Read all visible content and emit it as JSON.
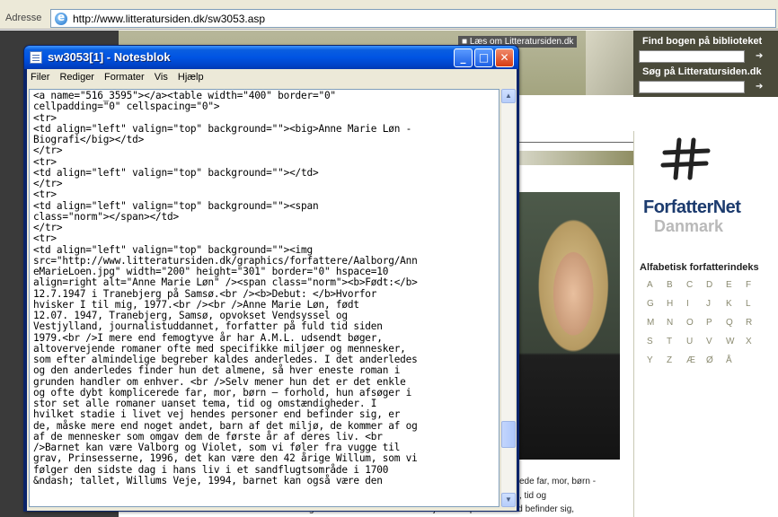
{
  "browser": {
    "address_label": "Adresse",
    "url": "http://www.litteratursiden.dk/sw3053.asp"
  },
  "site": {
    "header_link": "■ Læs om Litteratursiden.dk",
    "find_book_title": "Find bogen på biblioteket",
    "search_site_title": "Søg på Litteratursiden.dk",
    "arrow_glyph": "➔",
    "logo_name": "ForfatterNet",
    "logo_sub": "Danmark",
    "index_title": "Alfabetisk forfatterindeks",
    "index_letters": [
      "A",
      "B",
      "C",
      "D",
      "E",
      "F",
      "G",
      "H",
      "I",
      "J",
      "K",
      "L",
      "M",
      "N",
      "O",
      "P",
      "Q",
      "R",
      "S",
      "T",
      "U",
      "V",
      "W",
      "X",
      "Y",
      "Z",
      "Æ",
      "Ø",
      "Å"
    ],
    "snippet_1": "ede far, mor, børn -",
    "snippet_2": ", tid og",
    "snippet_3": "omstændigheder. I hvilket stadie i livet vej hendes personer end befinder sig,"
  },
  "notepad": {
    "title": "sw3053[1] - Notesblok",
    "menus": [
      "Filer",
      "Rediger",
      "Formater",
      "Vis",
      "Hjælp"
    ],
    "buttons": {
      "minimize": "_",
      "maximize": "□",
      "close": "✕"
    },
    "content": "<a name=\"516_3595\"></a><table width=\"400\" border=\"0\"\ncellpadding=\"0\" cellspacing=\"0\">\n<tr>\n<td align=\"left\" valign=\"top\" background=\"\"><big>Anne Marie Løn -\nBiografi</big></td>\n</tr>\n<tr>\n<td align=\"left\" valign=\"top\" background=\"\"></td>\n</tr>\n<tr>\n<td align=\"left\" valign=\"top\" background=\"\"><span\nclass=\"norm\"></span></td>\n</tr>\n<tr>\n<td align=\"left\" valign=\"top\" background=\"\"><img\nsrc=\"http://www.litteratursiden.dk/graphics/forfattere/Aalborg/Ann\neMarieLoen.jpg\" width=\"200\" height=\"301\" border=\"0\" hspace=10\nalign=right alt=\"Anne Marie Løn\" /><span class=\"norm\"><b>Født:</b>\n12.7.1947 i Tranebjerg på Samsø.<br /><b>Debut: </b>Hvorfor\nhvisker I til mig, 1977.<br /><br />Anne Marie Løn, født\n12.07. 1947, Tranebjerg, Samsø, opvokset Vendsyssel og\nVestjylland, journalistuddannet, forfatter på fuld tid siden\n1979.<br />I mere end femogtyve år har A.M.L. udsendt bøger,\naltovervejende romaner ofte med specifikke miljøer og mennesker,\nsom efter almindelige begreber kaldes anderledes. I det anderledes\nog den anderledes finder hun det almene, så hver eneste roman i\ngrunden handler om enhver. <br />Selv mener hun det er det enkle\nog ofte dybt komplicerede far, mor, børn – forhold, hun afsøger i\nstor set alle romaner uanset tema, tid og omstændigheder. I\nhvilket stadie i livet vej hendes personer end befinder sig, er\nde, måske mere end noget andet, barn af det miljø, de kommer af og\naf de mennesker som omgav dem de første år af deres liv. <br\n/>Barnet kan være Valborg og Violet, som vi føler fra vugge til\ngrav, Prinsesserne, 1996, det kan være den 42 årige Willum, som vi\nfølger den sidste dag i hans liv i et sandflugtsområde i 1700\n&ndash; tallet, Willums Veje, 1994, barnet kan også være den"
  }
}
